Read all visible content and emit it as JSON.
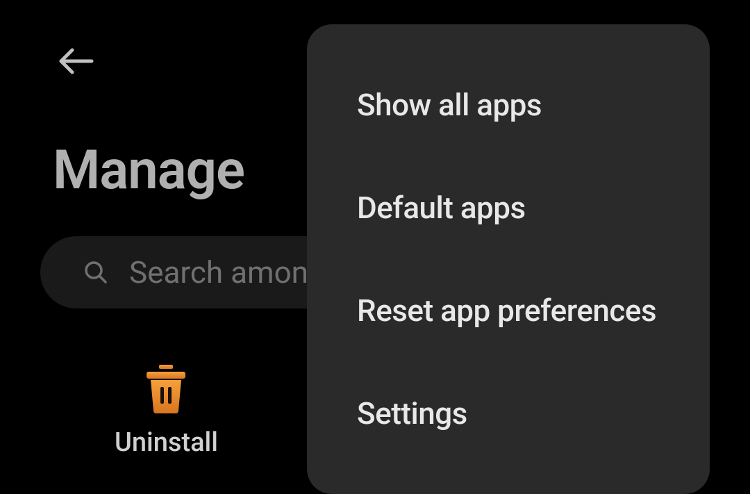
{
  "header": {
    "title": "Manage"
  },
  "search": {
    "placeholder": "Search amon"
  },
  "uninstall": {
    "label": "Uninstall"
  },
  "menu": {
    "items": [
      "Show all apps",
      "Default apps",
      "Reset app preferences",
      "Settings"
    ]
  }
}
